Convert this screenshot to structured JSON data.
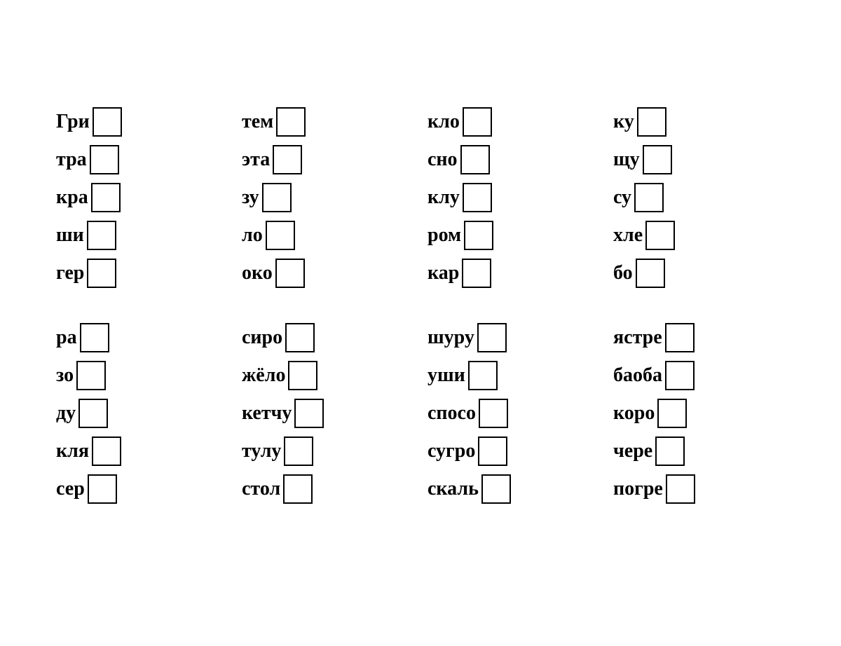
{
  "sections": [
    {
      "columns": [
        [
          {
            "prefix": "Гри"
          },
          {
            "prefix": "тра"
          },
          {
            "prefix": "кра"
          },
          {
            "prefix": "ши"
          },
          {
            "prefix": "гер"
          }
        ],
        [
          {
            "prefix": "тем"
          },
          {
            "prefix": "эта"
          },
          {
            "prefix": "зу"
          },
          {
            "prefix": "ло"
          },
          {
            "prefix": "око"
          }
        ],
        [
          {
            "prefix": "кло"
          },
          {
            "prefix": "сно"
          },
          {
            "prefix": "клу"
          },
          {
            "prefix": "ром"
          },
          {
            "prefix": "кар"
          }
        ],
        [
          {
            "prefix": "ку"
          },
          {
            "prefix": "щу"
          },
          {
            "prefix": "су"
          },
          {
            "prefix": "хле"
          },
          {
            "prefix": "бо"
          }
        ]
      ]
    },
    {
      "columns": [
        [
          {
            "prefix": "ра"
          },
          {
            "prefix": "зо"
          },
          {
            "prefix": "ду"
          },
          {
            "prefix": "кля"
          },
          {
            "prefix": "сер"
          }
        ],
        [
          {
            "prefix": "сиро"
          },
          {
            "prefix": "жёло"
          },
          {
            "prefix": "кетчу"
          },
          {
            "prefix": "тулу"
          },
          {
            "prefix": "стол"
          }
        ],
        [
          {
            "prefix": "шуру"
          },
          {
            "prefix": "уши"
          },
          {
            "prefix": "спосо"
          },
          {
            "prefix": "сугро"
          },
          {
            "prefix": "скаль"
          }
        ],
        [
          {
            "prefix": "ястре"
          },
          {
            "prefix": "бaoба"
          },
          {
            "prefix": "коро"
          },
          {
            "prefix": "чере"
          },
          {
            "prefix": "погре"
          }
        ]
      ]
    }
  ]
}
